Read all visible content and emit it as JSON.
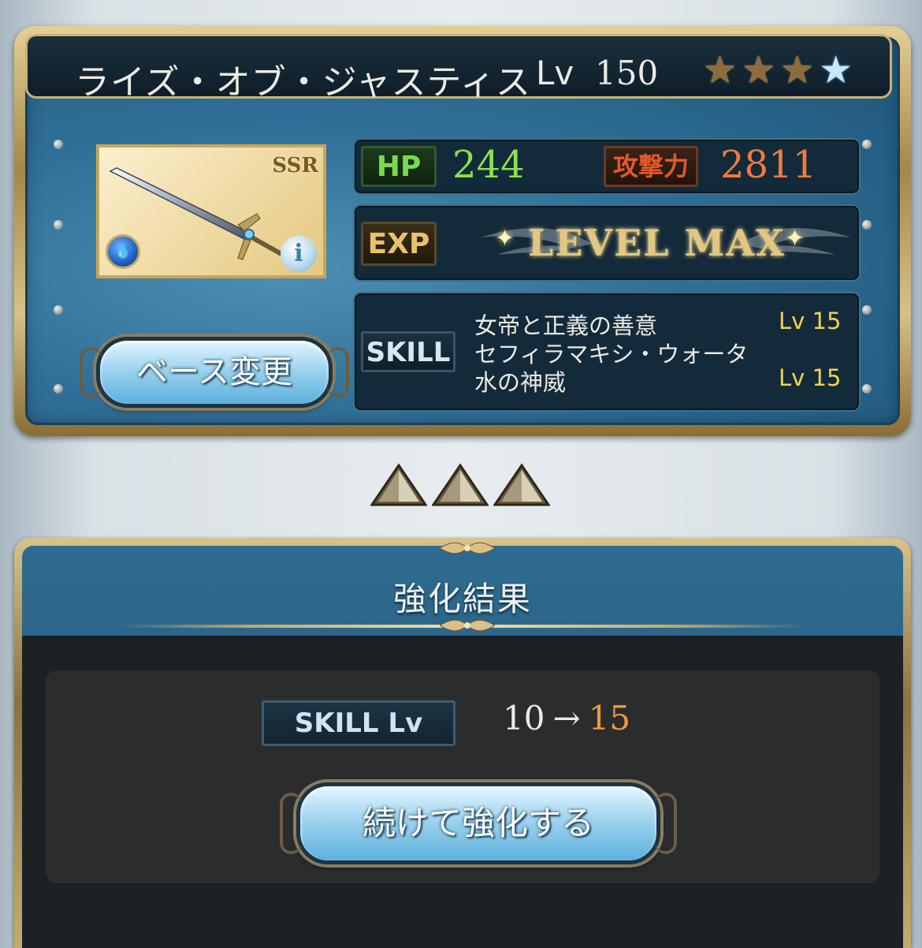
{
  "weapon": {
    "name": "ライズ・オブ・ジャスティス",
    "level_label": "Lv",
    "level": "150",
    "stars": [
      "★",
      "★",
      "★",
      "★"
    ],
    "rarity": "SSR",
    "element_icon": "water-element-icon",
    "info_icon_glyph": "i"
  },
  "stats": {
    "hp_label": "HP",
    "hp": "244",
    "atk_label": "攻撃力",
    "atk": "2811",
    "exp_label": "EXP",
    "exp_status": "LEVEL MAX"
  },
  "skills": {
    "label": "SKILL",
    "items": [
      {
        "name": "女帝と正義の善意",
        "level": "Lv 15"
      },
      {
        "name": "セフィラマキシ・ウォータ",
        "level": ""
      },
      {
        "name": "水の神威",
        "level": "Lv 15"
      }
    ]
  },
  "buttons": {
    "base_change": "ベース変更",
    "continue": "続けて強化する"
  },
  "result": {
    "title": "強化結果",
    "skill_lv_label": "SKILL Lv",
    "from": "10",
    "arrow": "→",
    "to": "15"
  },
  "colors": {
    "hp": "#8be14a",
    "atk": "#f07a3e",
    "skill_level": "#f2d34c",
    "level_to": "#f29a3b"
  }
}
